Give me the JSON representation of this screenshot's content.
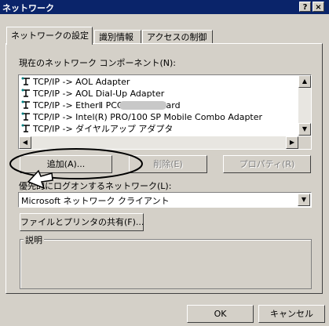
{
  "window": {
    "title": "ネットワーク",
    "help_button": "?",
    "close_button": "×"
  },
  "tabs": [
    {
      "label": "ネットワークの設定",
      "active": true
    },
    {
      "label": "識別情報",
      "active": false
    },
    {
      "label": "アクセスの制御",
      "active": false
    }
  ],
  "components": {
    "label": "現在のネットワーク コンポーネント(N):",
    "items": [
      "TCP/IP -> AOL Adapter",
      "TCP/IP -> AOL Dial-Up Adapter",
      "TCP/IP ->          EtherⅡ PCC-TD LAN Card",
      "TCP/IP -> Intel(R) PRO/100 SP Mobile Combo Adapter",
      "TCP/IP -> ダイヤルアップ アダプタ"
    ]
  },
  "buttons": {
    "add": "追加(A)...",
    "remove": "削除(E)",
    "properties": "プロパティ(R)",
    "file_print_share": "ファイルとプリンタの共有(F)...",
    "ok": "OK",
    "cancel": "キャンセル"
  },
  "logon": {
    "label": "優先的にログオンするネットワーク(L):",
    "selected": "Microsoft ネットワーク クライアント"
  },
  "description": {
    "label": "説明"
  },
  "icons": {
    "network_component": "network-adapter-icon",
    "scroll_up": "scroll-up-arrow",
    "scroll_down": "scroll-down-arrow",
    "scroll_left": "scroll-left-arrow",
    "scroll_right": "scroll-right-arrow",
    "dropdown": "dropdown-arrow"
  }
}
